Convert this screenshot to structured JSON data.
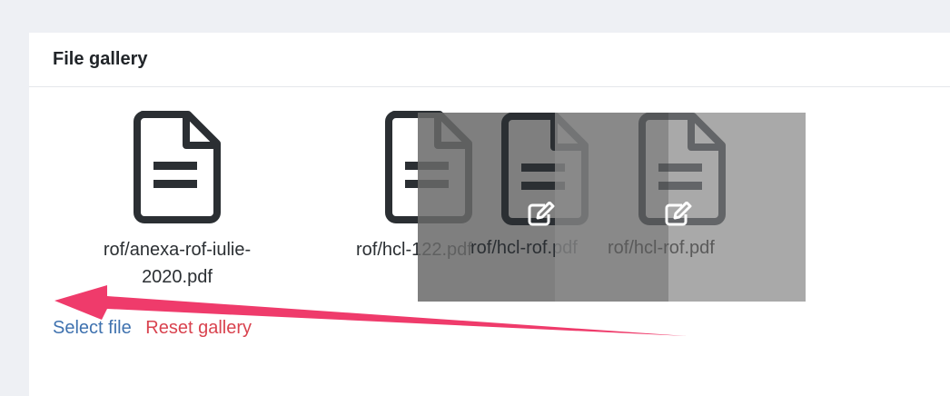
{
  "gallery": {
    "title": "File gallery",
    "files": [
      {
        "name": "rof/anexa-rof-iulie-2020.pdf",
        "line1": "rof/anexa-rof-iulie-",
        "line2": "2020.pdf",
        "icon": "file-text-icon"
      },
      {
        "name": "rof/hcl-122.pdf",
        "icon": "file-text-icon"
      }
    ],
    "drag_previews": [
      {
        "name": "rof/hcl-rof.pdf",
        "icon": "file-text-icon",
        "edit_icon": "edit-icon"
      },
      {
        "name": "rof/hcl-rof.pdf",
        "icon": "file-text-icon",
        "edit_icon": "edit-icon"
      }
    ],
    "actions": {
      "select_file": "Select file",
      "reset_gallery": "Reset gallery"
    }
  },
  "colors": {
    "link_blue": "#3f72af",
    "link_red": "#d9434f",
    "arrow": "#ef3b6b"
  }
}
